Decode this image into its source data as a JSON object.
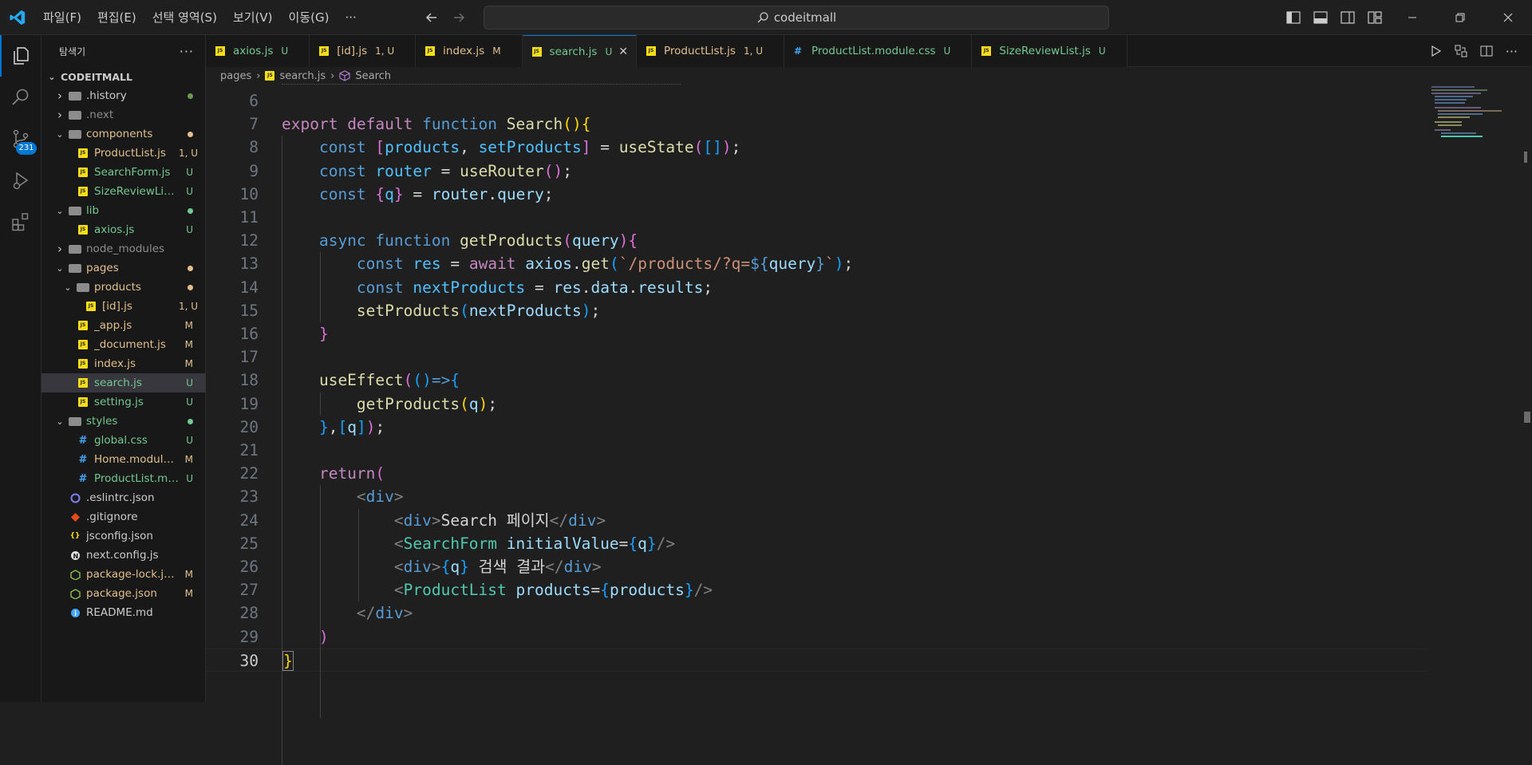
{
  "titlebar": {
    "menu": [
      "파일(F)",
      "편집(E)",
      "선택 영역(S)",
      "보기(V)",
      "이동(G)",
      "···"
    ],
    "search": "codeitmall"
  },
  "activity": {
    "scm_badge": "231"
  },
  "sidebar": {
    "header": "탐색기",
    "project": "CODEITMALL",
    "items": [
      {
        "label": ".history",
        "kind": "folder",
        "indent": 1,
        "chev": "right",
        "status": "dot",
        "color": "#cccccc",
        "stcolor": "#6a9955"
      },
      {
        "label": ".next",
        "kind": "folder",
        "indent": 1,
        "chev": "right",
        "status": "",
        "color": "#8c8c8c"
      },
      {
        "label": "components",
        "kind": "folder-open",
        "indent": 1,
        "chev": "down",
        "status": "dot",
        "color": "#e2c08d",
        "stcolor": "#e2c08d"
      },
      {
        "label": "ProductList.js",
        "kind": "js",
        "indent": 2,
        "status": "1, U",
        "color": "#e2c08d",
        "stcolor": "#e2c08d"
      },
      {
        "label": "SearchForm.js",
        "kind": "js",
        "indent": 2,
        "status": "U",
        "color": "#73c991",
        "stcolor": "#73c991"
      },
      {
        "label": "SizeReviewList.js",
        "kind": "js",
        "indent": 2,
        "status": "U",
        "color": "#73c991",
        "stcolor": "#73c991"
      },
      {
        "label": "lib",
        "kind": "folder-open",
        "indent": 1,
        "chev": "down",
        "status": "dot",
        "color": "#73c991",
        "stcolor": "#73c991"
      },
      {
        "label": "axios.js",
        "kind": "js",
        "indent": 2,
        "status": "U",
        "color": "#73c991",
        "stcolor": "#73c991"
      },
      {
        "label": "node_modules",
        "kind": "folder",
        "indent": 1,
        "chev": "right",
        "status": "",
        "color": "#8c8c8c"
      },
      {
        "label": "pages",
        "kind": "folder-open",
        "indent": 1,
        "chev": "down",
        "status": "dot",
        "color": "#e2c08d",
        "stcolor": "#e2c08d"
      },
      {
        "label": "products",
        "kind": "folder-open",
        "indent": 2,
        "chev": "down",
        "status": "dot",
        "color": "#e2c08d",
        "stcolor": "#e2c08d"
      },
      {
        "label": "[id].js",
        "kind": "js",
        "indent": 3,
        "status": "1, U",
        "color": "#e2c08d",
        "stcolor": "#e2c08d"
      },
      {
        "label": "_app.js",
        "kind": "js",
        "indent": 2,
        "status": "M",
        "color": "#e2c08d",
        "stcolor": "#e2c08d"
      },
      {
        "label": "_document.js",
        "kind": "js",
        "indent": 2,
        "status": "M",
        "color": "#e2c08d",
        "stcolor": "#e2c08d"
      },
      {
        "label": "index.js",
        "kind": "js",
        "indent": 2,
        "status": "M",
        "color": "#e2c08d",
        "stcolor": "#e2c08d"
      },
      {
        "label": "search.js",
        "kind": "js",
        "indent": 2,
        "status": "U",
        "color": "#73c991",
        "stcolor": "#73c991",
        "selected": true
      },
      {
        "label": "setting.js",
        "kind": "js",
        "indent": 2,
        "status": "U",
        "color": "#73c991",
        "stcolor": "#73c991"
      },
      {
        "label": "styles",
        "kind": "folder-open",
        "indent": 1,
        "chev": "down",
        "status": "dot",
        "color": "#73c991",
        "stcolor": "#73c991"
      },
      {
        "label": "global.css",
        "kind": "css",
        "indent": 2,
        "status": "U",
        "color": "#73c991",
        "stcolor": "#73c991"
      },
      {
        "label": "Home.module....",
        "kind": "css",
        "indent": 2,
        "status": "M",
        "color": "#e2c08d",
        "stcolor": "#e2c08d"
      },
      {
        "label": "ProductList.mo...",
        "kind": "css",
        "indent": 2,
        "status": "U",
        "color": "#73c991",
        "stcolor": "#73c991"
      },
      {
        "label": ".eslintrc.json",
        "kind": "eslint",
        "indent": 1,
        "status": "",
        "color": "#cccccc"
      },
      {
        "label": ".gitignore",
        "kind": "git",
        "indent": 1,
        "status": "",
        "color": "#cccccc"
      },
      {
        "label": "jsconfig.json",
        "kind": "json",
        "indent": 1,
        "status": "",
        "color": "#cccccc"
      },
      {
        "label": "next.config.js",
        "kind": "next",
        "indent": 1,
        "status": "",
        "color": "#cccccc"
      },
      {
        "label": "package-lock.js...",
        "kind": "node",
        "indent": 1,
        "status": "M",
        "color": "#e2c08d",
        "stcolor": "#e2c08d"
      },
      {
        "label": "package.json",
        "kind": "node",
        "indent": 1,
        "status": "M",
        "color": "#e2c08d",
        "stcolor": "#e2c08d"
      },
      {
        "label": "README.md",
        "kind": "info",
        "indent": 1,
        "status": "",
        "color": "#cccccc"
      }
    ]
  },
  "tabs": [
    {
      "label": "axios.js",
      "status": "U",
      "icon": "js",
      "color": "#73c991"
    },
    {
      "label": "[id].js",
      "status": "1, U",
      "icon": "js",
      "color": "#e2c08d"
    },
    {
      "label": "index.js",
      "status": "M",
      "icon": "js",
      "color": "#e2c08d"
    },
    {
      "label": "search.js",
      "status": "U",
      "icon": "js",
      "color": "#73c991",
      "active": true
    },
    {
      "label": "ProductList.js",
      "status": "1, U",
      "icon": "js",
      "color": "#e2c08d"
    },
    {
      "label": "ProductList.module.css",
      "status": "U",
      "icon": "css",
      "color": "#73c991"
    },
    {
      "label": "SizeReviewList.js",
      "status": "U",
      "icon": "js",
      "color": "#73c991"
    }
  ],
  "breadcrumb": [
    "pages",
    "search.js",
    "Search"
  ],
  "code": [
    {
      "n": "6",
      "t": []
    },
    {
      "n": "7",
      "t": [
        [
          "export ",
          "k"
        ],
        [
          "default ",
          "k"
        ],
        [
          "function ",
          "b"
        ],
        [
          "Search",
          "f"
        ],
        [
          "()",
          "y"
        ],
        [
          "{",
          "y"
        ]
      ]
    },
    {
      "n": "8",
      "t": [
        [
          "    const ",
          "b"
        ],
        [
          "[",
          "p"
        ],
        [
          "products",
          "c"
        ],
        [
          ", ",
          "w"
        ],
        [
          "setProducts",
          "c"
        ],
        [
          "]",
          "p"
        ],
        [
          " = ",
          "w"
        ],
        [
          "useState",
          "f"
        ],
        [
          "(",
          "p"
        ],
        [
          "[]",
          "l"
        ],
        [
          ")",
          "p"
        ],
        [
          ";",
          "w"
        ]
      ]
    },
    {
      "n": "9",
      "t": [
        [
          "    const ",
          "b"
        ],
        [
          "router",
          "c"
        ],
        [
          " = ",
          "w"
        ],
        [
          "useRouter",
          "f"
        ],
        [
          "()",
          "p"
        ],
        [
          ";",
          "w"
        ]
      ]
    },
    {
      "n": "10",
      "t": [
        [
          "    const ",
          "b"
        ],
        [
          "{",
          "p"
        ],
        [
          "q",
          "c"
        ],
        [
          "}",
          "p"
        ],
        [
          " = ",
          "w"
        ],
        [
          "router",
          "v"
        ],
        [
          ".",
          "w"
        ],
        [
          "query",
          "v"
        ],
        [
          ";",
          "w"
        ]
      ]
    },
    {
      "n": "11",
      "t": []
    },
    {
      "n": "12",
      "t": [
        [
          "    async ",
          "b"
        ],
        [
          "function ",
          "b"
        ],
        [
          "getProducts",
          "f"
        ],
        [
          "(",
          "p"
        ],
        [
          "query",
          "v"
        ],
        [
          ")",
          "p"
        ],
        [
          "{",
          "p"
        ]
      ]
    },
    {
      "n": "13",
      "t": [
        [
          "        const ",
          "b"
        ],
        [
          "res",
          "c"
        ],
        [
          " = ",
          "w"
        ],
        [
          "await ",
          "k"
        ],
        [
          "axios",
          "v"
        ],
        [
          ".",
          "w"
        ],
        [
          "get",
          "f"
        ],
        [
          "(",
          "l"
        ],
        [
          "`/products/?q=",
          "s"
        ],
        [
          "${",
          "b"
        ],
        [
          "query",
          "v"
        ],
        [
          "}",
          "b"
        ],
        [
          "`",
          "s"
        ],
        [
          ")",
          "l"
        ],
        [
          ";",
          "w"
        ]
      ]
    },
    {
      "n": "14",
      "t": [
        [
          "        const ",
          "b"
        ],
        [
          "nextProducts",
          "c"
        ],
        [
          " = ",
          "w"
        ],
        [
          "res",
          "v"
        ],
        [
          ".",
          "w"
        ],
        [
          "data",
          "v"
        ],
        [
          ".",
          "w"
        ],
        [
          "results",
          "v"
        ],
        [
          ";",
          "w"
        ]
      ]
    },
    {
      "n": "15",
      "t": [
        [
          "        setProducts",
          "f"
        ],
        [
          "(",
          "l"
        ],
        [
          "nextProducts",
          "v"
        ],
        [
          ")",
          "l"
        ],
        [
          ";",
          "w"
        ]
      ]
    },
    {
      "n": "16",
      "t": [
        [
          "    }",
          "p"
        ]
      ]
    },
    {
      "n": "17",
      "t": []
    },
    {
      "n": "18",
      "t": [
        [
          "    useEffect",
          "f"
        ],
        [
          "(",
          "p"
        ],
        [
          "()",
          "l"
        ],
        [
          "=>",
          "b"
        ],
        [
          "{",
          "l"
        ]
      ]
    },
    {
      "n": "19",
      "t": [
        [
          "        getProducts",
          "f"
        ],
        [
          "(",
          "y"
        ],
        [
          "q",
          "v"
        ],
        [
          ")",
          "y"
        ],
        [
          ";",
          "w"
        ]
      ]
    },
    {
      "n": "20",
      "t": [
        [
          "    }",
          "l"
        ],
        [
          ",",
          "w"
        ],
        [
          "[",
          "l"
        ],
        [
          "q",
          "v"
        ],
        [
          "]",
          "l"
        ],
        [
          ")",
          "p"
        ],
        [
          ";",
          "w"
        ]
      ]
    },
    {
      "n": "21",
      "t": []
    },
    {
      "n": "22",
      "t": [
        [
          "    return",
          "k"
        ],
        [
          "(",
          "p"
        ]
      ]
    },
    {
      "n": "23",
      "t": [
        [
          "        <",
          "g"
        ],
        [
          "div",
          "b"
        ],
        [
          ">",
          "g"
        ]
      ]
    },
    {
      "n": "24",
      "t": [
        [
          "            <",
          "g"
        ],
        [
          "div",
          "b"
        ],
        [
          ">",
          "g"
        ],
        [
          "Search 페이지",
          "w"
        ],
        [
          "</",
          "g"
        ],
        [
          "div",
          "b"
        ],
        [
          ">",
          "g"
        ]
      ]
    },
    {
      "n": "25",
      "t": [
        [
          "            <",
          "g"
        ],
        [
          "SearchForm ",
          "t"
        ],
        [
          "initialValue",
          "v"
        ],
        [
          "=",
          "w"
        ],
        [
          "{",
          "l"
        ],
        [
          "q",
          "v"
        ],
        [
          "}",
          "l"
        ],
        [
          "/>",
          "g"
        ]
      ]
    },
    {
      "n": "26",
      "t": [
        [
          "            <",
          "g"
        ],
        [
          "div",
          "b"
        ],
        [
          ">",
          "g"
        ],
        [
          "{",
          "l"
        ],
        [
          "q",
          "v"
        ],
        [
          "}",
          "l"
        ],
        [
          " 검색 결과",
          "w"
        ],
        [
          "</",
          "g"
        ],
        [
          "div",
          "b"
        ],
        [
          ">",
          "g"
        ]
      ]
    },
    {
      "n": "27",
      "t": [
        [
          "            <",
          "g"
        ],
        [
          "ProductList ",
          "t"
        ],
        [
          "products",
          "v"
        ],
        [
          "=",
          "w"
        ],
        [
          "{",
          "l"
        ],
        [
          "products",
          "v"
        ],
        [
          "}",
          "l"
        ],
        [
          "/>",
          "g"
        ]
      ]
    },
    {
      "n": "28",
      "t": [
        [
          "        </",
          "g"
        ],
        [
          "div",
          "b"
        ],
        [
          ">",
          "g"
        ]
      ]
    },
    {
      "n": "29",
      "t": [
        [
          "    )",
          "p"
        ]
      ]
    },
    {
      "n": "30",
      "t": [
        [
          "}",
          "y"
        ]
      ],
      "cur": true
    }
  ]
}
